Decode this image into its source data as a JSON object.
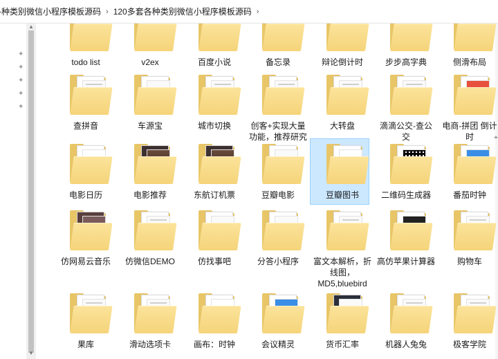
{
  "breadcrumb": {
    "items": [
      "各种类别微信小程序模板源码",
      "120多套各种类别微信小程序模板源码"
    ],
    "separator": "›"
  },
  "nav": {
    "pins": 5
  },
  "rows": [
    [
      {
        "label": "todo list",
        "thumb": "dark"
      },
      {
        "label": "v2ex",
        "thumb": "list"
      },
      {
        "label": "百度小说",
        "thumb": "list"
      },
      {
        "label": "备忘录",
        "thumb": "list"
      },
      {
        "label": "辩论倒计时",
        "thumb": "list"
      },
      {
        "label": "步步高字典",
        "thumb": "list"
      },
      {
        "label": "侧滑布局",
        "thumb": "list"
      }
    ],
    [
      {
        "label": "查拼音",
        "thumb": "list"
      },
      {
        "label": "车源宝",
        "thumb": "blank"
      },
      {
        "label": "城市切换",
        "thumb": "list"
      },
      {
        "label": "创客+实现大量功能，推荐研究",
        "thumb": "list"
      },
      {
        "label": "大转盘",
        "thumb": "list"
      },
      {
        "label": "滴滴公交-查公交",
        "thumb": "list"
      },
      {
        "label": "电商-拼团 倒计时",
        "thumb": "shop"
      }
    ],
    [
      {
        "label": "电影日历",
        "thumb": "calendar"
      },
      {
        "label": "电影推荐",
        "thumb": "movie"
      },
      {
        "label": "东航订机票",
        "thumb": "movie"
      },
      {
        "label": "豆瓣电影",
        "thumb": "blank"
      },
      {
        "label": "豆瓣图书",
        "thumb": "green",
        "selected": true
      },
      {
        "label": "二维码生成器",
        "thumb": "qr"
      },
      {
        "label": "番茄时钟",
        "thumb": "blue"
      }
    ],
    [
      {
        "label": "仿网易云音乐",
        "thumb": "music"
      },
      {
        "label": "仿微信DEMO",
        "thumb": "list"
      },
      {
        "label": "仿找事吧",
        "thumb": "blank"
      },
      {
        "label": "分答小程序",
        "thumb": "blank"
      },
      {
        "label": "富文本解析，折线图，MD5,bluebird",
        "thumb": "list"
      },
      {
        "label": "高仿苹果计算器",
        "thumb": "calc"
      },
      {
        "label": "购物车",
        "thumb": "list"
      }
    ],
    [
      {
        "label": "果库",
        "thumb": "list"
      },
      {
        "label": "滑动选项卡",
        "thumb": "list"
      },
      {
        "label": "画布：时钟",
        "thumb": "clock"
      },
      {
        "label": "会议精灵",
        "thumb": "blue"
      },
      {
        "label": "货币汇率",
        "thumb": "dark"
      },
      {
        "label": "机器人兔兔",
        "thumb": "list"
      },
      {
        "label": "极客学院",
        "thumb": "list"
      }
    ]
  ],
  "colors": {
    "folder_back": "#e8c668",
    "folder_front": "#f5d47a",
    "selection": "#cce8ff",
    "selection_border": "#99d1ff"
  }
}
